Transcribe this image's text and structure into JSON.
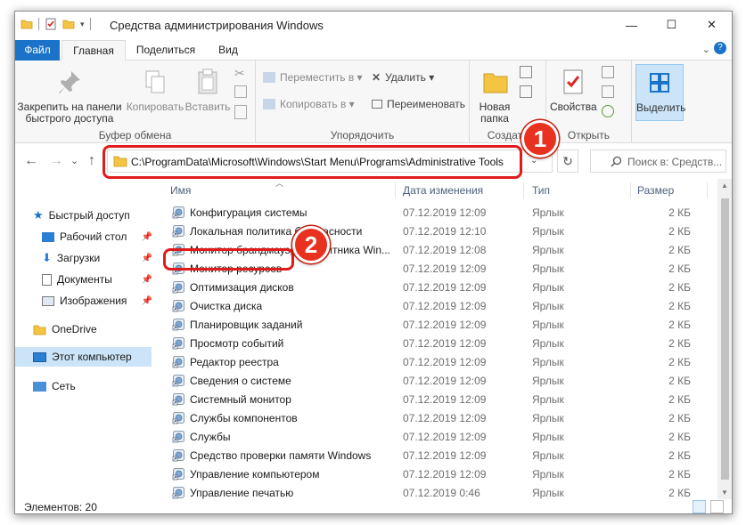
{
  "window": {
    "title": "Средства администрирования Windows",
    "minimize_glyph": "—",
    "maximize_glyph": "☐",
    "close_glyph": "✕"
  },
  "tabs": [
    {
      "label": "Файл"
    },
    {
      "label": "Главная"
    },
    {
      "label": "Поделиться"
    },
    {
      "label": "Вид"
    }
  ],
  "ribbon": {
    "help_glyph": "?",
    "clipboard_group": {
      "label": "Буфер обмена",
      "pin_label": "Закрепить на панели быстрого доступа",
      "copy_label": "Копировать",
      "paste_label": "Вставить"
    },
    "organize_group": {
      "label": "Упорядочить",
      "move_label": "Переместить в ▾",
      "copyto_label": "Копировать в ▾",
      "delete_label": "Удалить ▾",
      "rename_label": "Переименовать"
    },
    "create_group": {
      "label": "Создать",
      "newfolder_label": "Новая папка"
    },
    "open_group": {
      "label": "Открыть",
      "properties_label": "Свойства"
    },
    "select_group": {
      "select_label": "Выделить"
    }
  },
  "navigation": {
    "back": "←",
    "forward": "→",
    "recent": "⌄",
    "up": "↑",
    "refresh": "↻",
    "dropdown": "⌄",
    "address": "C:\\ProgramData\\Microsoft\\Windows\\Start Menu\\Programs\\Administrative Tools",
    "search_placeholder": "Поиск в: Средств..."
  },
  "annotations": {
    "badge1": "1",
    "badge2": "2"
  },
  "sidebar": {
    "pin_glyph": "📌",
    "items": [
      {
        "label": "Быстрый доступ"
      },
      {
        "label": "Рабочий стол"
      },
      {
        "label": "Загрузки"
      },
      {
        "label": "Документы"
      },
      {
        "label": "Изображения"
      },
      {
        "label": "OneDrive"
      },
      {
        "label": "Этот компьютер"
      },
      {
        "label": "Сеть"
      }
    ]
  },
  "columns": {
    "name": "Имя",
    "date": "Дата изменения",
    "type": "Тип",
    "size": "Размер"
  },
  "files": [
    {
      "name": "Конфигурация системы",
      "date": "07.12.2019 12:09",
      "type": "Ярлык",
      "size": "2 КБ"
    },
    {
      "name": "Локальная политика безопасности",
      "date": "07.12.2019 12:10",
      "type": "Ярлык",
      "size": "2 КБ"
    },
    {
      "name": "Монитор брандмауэра Защитника Win...",
      "date": "07.12.2019 12:08",
      "type": "Ярлык",
      "size": "2 КБ"
    },
    {
      "name": "Монитор ресурсов",
      "date": "07.12.2019 12:09",
      "type": "Ярлык",
      "size": "2 КБ"
    },
    {
      "name": "Оптимизация дисков",
      "date": "07.12.2019 12:09",
      "type": "Ярлык",
      "size": "2 КБ"
    },
    {
      "name": "Очистка диска",
      "date": "07.12.2019 12:09",
      "type": "Ярлык",
      "size": "2 КБ"
    },
    {
      "name": "Планировщик заданий",
      "date": "07.12.2019 12:09",
      "type": "Ярлык",
      "size": "2 КБ"
    },
    {
      "name": "Просмотр событий",
      "date": "07.12.2019 12:09",
      "type": "Ярлык",
      "size": "2 КБ"
    },
    {
      "name": "Редактор реестра",
      "date": "07.12.2019 12:09",
      "type": "Ярлык",
      "size": "2 КБ"
    },
    {
      "name": "Сведения о системе",
      "date": "07.12.2019 12:09",
      "type": "Ярлык",
      "size": "2 КБ"
    },
    {
      "name": "Системный монитор",
      "date": "07.12.2019 12:09",
      "type": "Ярлык",
      "size": "2 КБ"
    },
    {
      "name": "Службы компонентов",
      "date": "07.12.2019 12:09",
      "type": "Ярлык",
      "size": "2 КБ"
    },
    {
      "name": "Службы",
      "date": "07.12.2019 12:09",
      "type": "Ярлык",
      "size": "2 КБ"
    },
    {
      "name": "Средство проверки памяти Windows",
      "date": "07.12.2019 12:09",
      "type": "Ярлык",
      "size": "2 КБ"
    },
    {
      "name": "Управление компьютером",
      "date": "07.12.2019 12:09",
      "type": "Ярлык",
      "size": "2 КБ"
    },
    {
      "name": "Управление печатью",
      "date": "07.12.2019 0:46",
      "type": "Ярлык",
      "size": "2 КБ"
    }
  ],
  "status": {
    "items_count": "Элементов: 20"
  },
  "colors": {
    "accent": "#1a73c8",
    "annotation_red": "#e01b1b",
    "selected_nav": "#cce4f7"
  }
}
